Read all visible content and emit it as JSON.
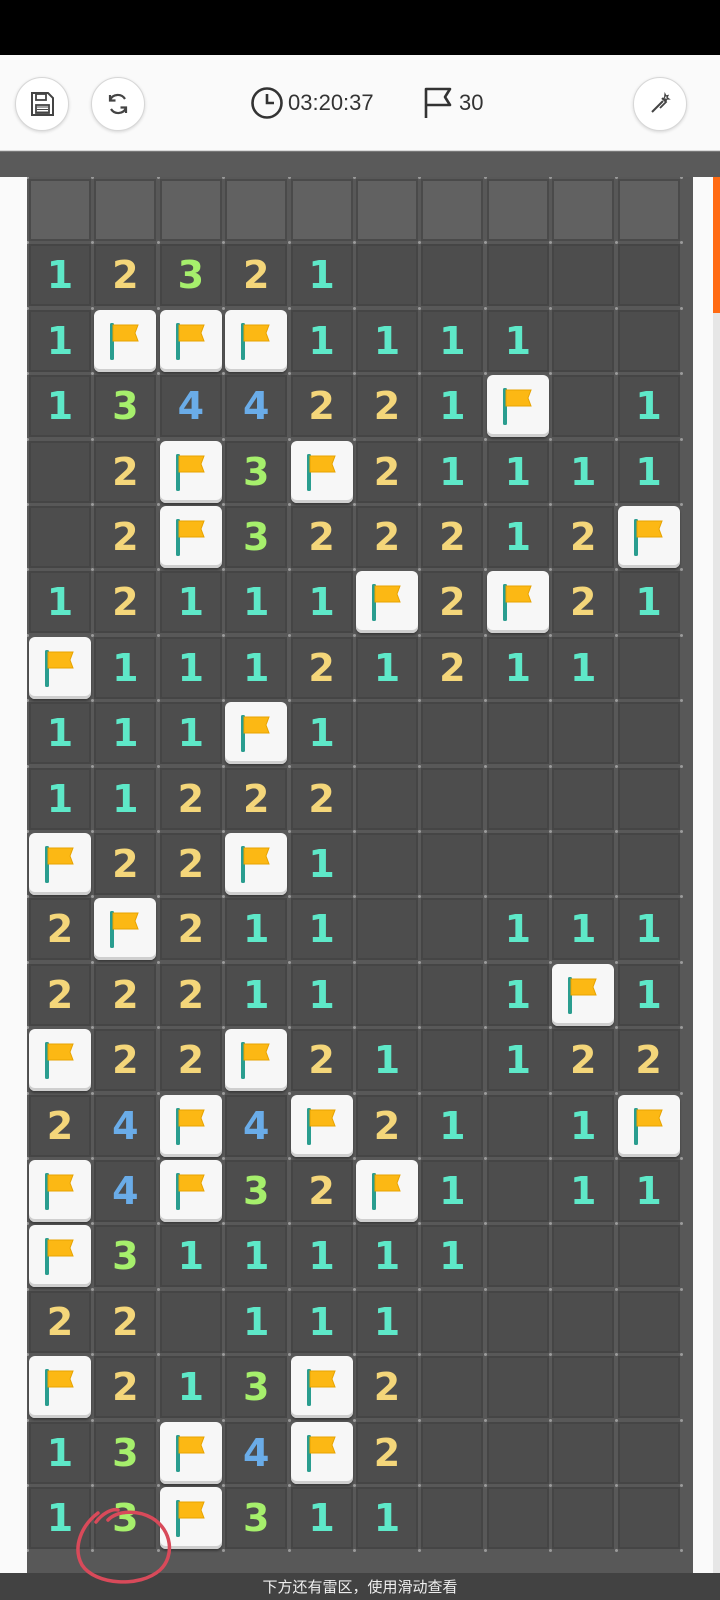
{
  "toolbar": {
    "save_icon": "floppy-disk-icon",
    "restart_icon": "refresh-icon",
    "timer_icon": "clock-icon",
    "timer": "03:20:37",
    "flag_icon": "flag-outline-icon",
    "flag_count": "30",
    "hint_icon": "magic-wand-icon"
  },
  "board": {
    "cols": 10,
    "rows_visible": 21,
    "legend": "c = closed, o = open empty, F = flagged, 1-8 = revealed number",
    "rows": [
      "cccccccccc",
      "12321ooooo",
      "1FFF1111oo",
      "1344221Fo1",
      "o2F3F21111",
      "o2F322212F",
      "12111F2F21",
      "F11121211o",
      "111F1ooooo",
      "11222ooooo",
      "F22F1ooooo",
      "2F211oo111",
      "22211oo1F1",
      "F22F21o122",
      "24F4F21o1F",
      "F4F32F1o11",
      "F311111ooo",
      "22o111oooo",
      "F213F2oooo",
      "13F4F2oooo",
      "13F311oooo"
    ],
    "number_colors": {
      "1": "#5ee8c8",
      "2": "#f4d67a",
      "3": "#a6ef6c",
      "4": "#6aace8"
    },
    "flag_color": "#fcb814",
    "pole_color": "#2a9d8f"
  },
  "hint_text": "下方还有雷区，使用滑动查看",
  "accent_color": "#ff6a12",
  "annotation_color": "#d84a5a"
}
